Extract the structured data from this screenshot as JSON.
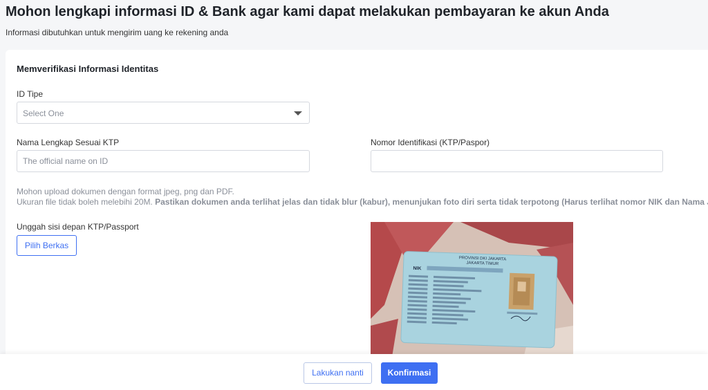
{
  "header": {
    "title": "Mohon lengkapi informasi ID & Bank agar kami dapat melakukan pembayaran ke akun Anda",
    "subtitle": "Informasi dibutuhkan untuk mengirim uang ke rekening anda"
  },
  "form": {
    "section_title": "Memverifikasi Informasi Identitas",
    "id_type": {
      "label": "ID Tipe",
      "value": "Select One"
    },
    "full_name": {
      "label": "Nama Lengkap Sesuai KTP",
      "placeholder": "The official name on ID"
    },
    "id_number": {
      "label": "Nomor Identifikasi (KTP/Paspor)",
      "placeholder": ""
    },
    "upload_note": {
      "line1": "Mohon upload dokumen dengan format jpeg, png dan PDF.",
      "line2_prefix": "Ukuran file tidak boleh melebihi 20M.",
      "line2_bold": "Pastikan dokumen anda terlihat jelas dan tidak blur (kabur), menunjukan foto diri serta tidak terpotong (Harus terlihat nomor NIK dan Nama Jelas)"
    },
    "upload_front": {
      "label": "Unggah sisi depan KTP/Passport",
      "button": "Pilih Berkas"
    },
    "id_card_preview": {
      "province": "PROVINSI DKI JAKARTA",
      "city": "JAKARTA TIMUR",
      "nik_label": "NIK"
    }
  },
  "footer": {
    "later_label": "Lakukan nanti",
    "confirm_label": "Konfirmasi"
  },
  "colors": {
    "accent": "#3e6ff2",
    "card_blue": "#a9d3df"
  }
}
